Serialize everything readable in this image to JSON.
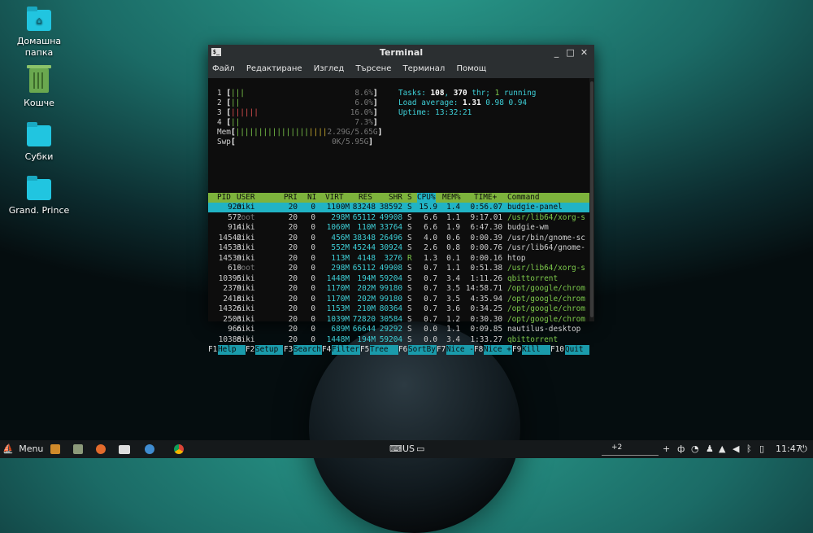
{
  "desktop": {
    "icons": [
      {
        "label": "Домашна папка",
        "icon": "home-folder-icon"
      },
      {
        "label": "Кошче",
        "icon": "trash-icon"
      },
      {
        "label": "Субки",
        "icon": "folder-icon"
      },
      {
        "label": "Grand. Prince",
        "icon": "folder-icon"
      }
    ]
  },
  "window": {
    "title": "Terminal",
    "controls": [
      "_",
      "□",
      "✕"
    ],
    "menu": [
      "Файл",
      "Редактиране",
      "Изглед",
      "Търсене",
      "Терминал",
      "Помощ"
    ]
  },
  "htop": {
    "cpus": [
      {
        "id": "1",
        "bar": "|||",
        "pct": "8.6%"
      },
      {
        "id": "2",
        "bar": "||",
        "pct": "6.0%"
      },
      {
        "id": "3",
        "bar": "||||||",
        "pct": "16.0%"
      },
      {
        "id": "4",
        "bar": "||",
        "pct": "7.3%"
      }
    ],
    "mem": {
      "label": "Mem",
      "bar": "||||||||||||||||",
      "value": "2.29G/5.65G"
    },
    "swp": {
      "label": "Swp",
      "value": "0K/5.95G"
    },
    "tasks": {
      "label": "Tasks:",
      "count": "108",
      "thr": "370",
      "thr_label": "thr;",
      "running": "1",
      "running_label": "running"
    },
    "load": {
      "label": "Load average:",
      "v1": "1.31",
      "v2": "0.98",
      "v3": "0.94"
    },
    "uptime": {
      "label": "Uptime:",
      "value": "13:32:21"
    },
    "columns": [
      "PID",
      "USER",
      "PRI",
      "NI",
      "VIRT",
      "RES",
      "SHR",
      "S",
      "CPU%",
      "MEM%",
      "TIME+",
      "Command"
    ],
    "processes": [
      {
        "pid": "920",
        "user": "niki",
        "pri": "20",
        "ni": "0",
        "virt": "1100M",
        "res": "83248",
        "shr": "38592",
        "s": "S",
        "cpu": "15.9",
        "mem": "1.4",
        "time": "0:56.07",
        "cmd": "budgie-panel"
      },
      {
        "pid": "572",
        "user": "root",
        "pri": "20",
        "ni": "0",
        "virt": "298M",
        "res": "65112",
        "shr": "49908",
        "s": "S",
        "cpu": "6.6",
        "mem": "1.1",
        "time": "9:17.01",
        "cmd": "/usr/lib64/xorg-s"
      },
      {
        "pid": "914",
        "user": "niki",
        "pri": "20",
        "ni": "0",
        "virt": "1060M",
        "res": "110M",
        "shr": "33764",
        "s": "S",
        "cpu": "6.6",
        "mem": "1.9",
        "time": "6:47.30",
        "cmd": "budgie-wm"
      },
      {
        "pid": "14542",
        "user": "niki",
        "pri": "20",
        "ni": "0",
        "virt": "456M",
        "res": "38348",
        "shr": "26496",
        "s": "S",
        "cpu": "4.0",
        "mem": "0.6",
        "time": "0:00.39",
        "cmd": "/usr/bin/gnome-sc"
      },
      {
        "pid": "14533",
        "user": "niki",
        "pri": "20",
        "ni": "0",
        "virt": "552M",
        "res": "45244",
        "shr": "30924",
        "s": "S",
        "cpu": "2.6",
        "mem": "0.8",
        "time": "0:00.76",
        "cmd": "/usr/lib64/gnome-"
      },
      {
        "pid": "14539",
        "user": "niki",
        "pri": "20",
        "ni": "0",
        "virt": "113M",
        "res": "4148",
        "shr": "3276",
        "s": "R",
        "cpu": "1.3",
        "mem": "0.1",
        "time": "0:00.16",
        "cmd": "htop"
      },
      {
        "pid": "610",
        "user": "root",
        "pri": "20",
        "ni": "0",
        "virt": "298M",
        "res": "65112",
        "shr": "49908",
        "s": "S",
        "cpu": "0.7",
        "mem": "1.1",
        "time": "0:51.38",
        "cmd": "/usr/lib64/xorg-s"
      },
      {
        "pid": "10395",
        "user": "niki",
        "pri": "20",
        "ni": "0",
        "virt": "1448M",
        "res": "194M",
        "shr": "59204",
        "s": "S",
        "cpu": "0.7",
        "mem": "3.4",
        "time": "1:11.26",
        "cmd": "qbittorrent"
      },
      {
        "pid": "2379",
        "user": "niki",
        "pri": "20",
        "ni": "0",
        "virt": "1170M",
        "res": "202M",
        "shr": "99180",
        "s": "S",
        "cpu": "0.7",
        "mem": "3.5",
        "time": "14:58.71",
        "cmd": "/opt/google/chrom"
      },
      {
        "pid": "2418",
        "user": "niki",
        "pri": "20",
        "ni": "0",
        "virt": "1170M",
        "res": "202M",
        "shr": "99180",
        "s": "S",
        "cpu": "0.7",
        "mem": "3.5",
        "time": "4:35.94",
        "cmd": "/opt/google/chrom"
      },
      {
        "pid": "14326",
        "user": "niki",
        "pri": "20",
        "ni": "0",
        "virt": "1153M",
        "res": "210M",
        "shr": "80364",
        "s": "S",
        "cpu": "0.7",
        "mem": "3.6",
        "time": "0:34.25",
        "cmd": "/opt/google/chrom"
      },
      {
        "pid": "2503",
        "user": "niki",
        "pri": "20",
        "ni": "0",
        "virt": "1039M",
        "res": "72820",
        "shr": "30584",
        "s": "S",
        "cpu": "0.7",
        "mem": "1.2",
        "time": "0:30.30",
        "cmd": "/opt/google/chrom"
      },
      {
        "pid": "966",
        "user": "niki",
        "pri": "20",
        "ni": "0",
        "virt": "689M",
        "res": "66644",
        "shr": "29292",
        "s": "S",
        "cpu": "0.0",
        "mem": "1.1",
        "time": "0:09.85",
        "cmd": "nautilus-desktop"
      },
      {
        "pid": "10388",
        "user": "niki",
        "pri": "20",
        "ni": "0",
        "virt": "1448M",
        "res": "194M",
        "shr": "59204",
        "s": "S",
        "cpu": "0.0",
        "mem": "3.4",
        "time": "1:33.27",
        "cmd": "qbittorrent"
      }
    ],
    "fkeys": [
      {
        "key": "F1",
        "label": "Help"
      },
      {
        "key": "F2",
        "label": "Setup"
      },
      {
        "key": "F3",
        "label": "Search"
      },
      {
        "key": "F4",
        "label": "Filter"
      },
      {
        "key": "F5",
        "label": "Tree"
      },
      {
        "key": "F6",
        "label": "SortBy"
      },
      {
        "key": "F7",
        "label": "Nice -"
      },
      {
        "key": "F8",
        "label": "Nice +"
      },
      {
        "key": "F9",
        "label": "Kill"
      },
      {
        "key": "F10",
        "label": "Quit"
      }
    ]
  },
  "panel": {
    "menu_label": "Menu",
    "keyboard_layout": "US",
    "workspace": "+2",
    "add": "+",
    "clock": "11:47",
    "colors": {
      "accent": "#21b3c4",
      "htop_green": "#7db33c"
    }
  }
}
